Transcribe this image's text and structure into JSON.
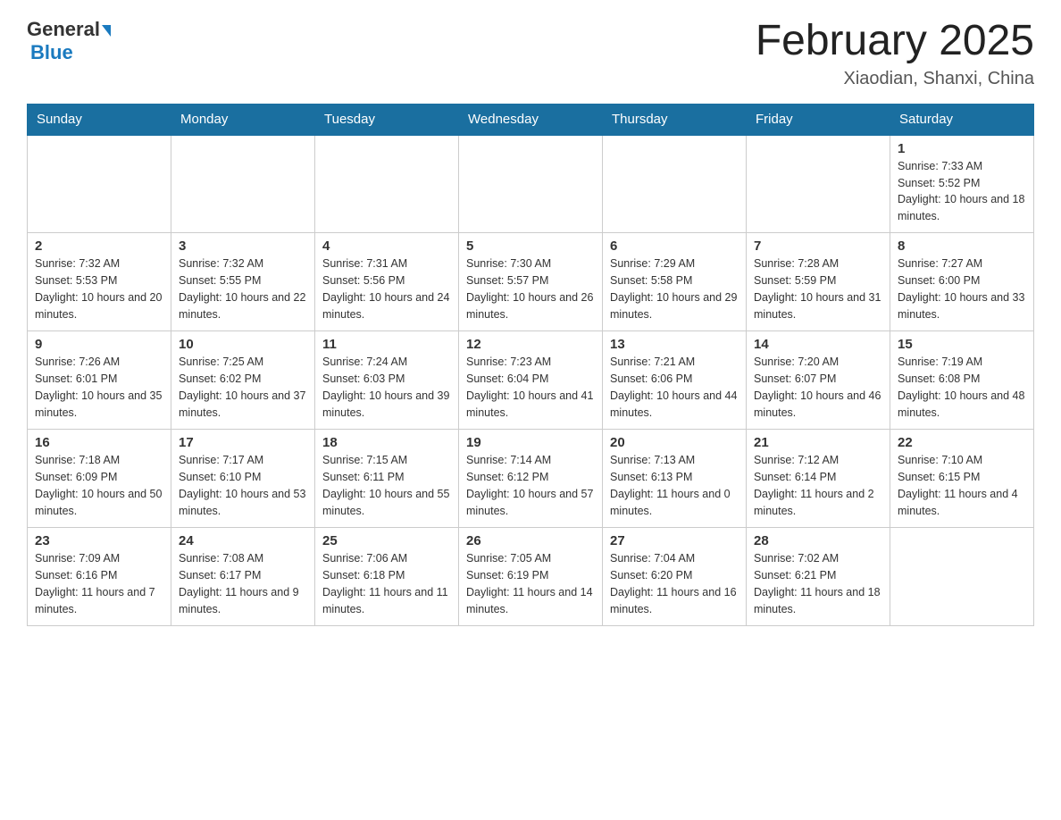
{
  "header": {
    "logo_general": "General",
    "logo_blue": "Blue",
    "title": "February 2025",
    "location": "Xiaodian, Shanxi, China"
  },
  "weekdays": [
    "Sunday",
    "Monday",
    "Tuesday",
    "Wednesday",
    "Thursday",
    "Friday",
    "Saturday"
  ],
  "weeks": [
    [
      {
        "day": "",
        "info": ""
      },
      {
        "day": "",
        "info": ""
      },
      {
        "day": "",
        "info": ""
      },
      {
        "day": "",
        "info": ""
      },
      {
        "day": "",
        "info": ""
      },
      {
        "day": "",
        "info": ""
      },
      {
        "day": "1",
        "info": "Sunrise: 7:33 AM\nSunset: 5:52 PM\nDaylight: 10 hours and 18 minutes."
      }
    ],
    [
      {
        "day": "2",
        "info": "Sunrise: 7:32 AM\nSunset: 5:53 PM\nDaylight: 10 hours and 20 minutes."
      },
      {
        "day": "3",
        "info": "Sunrise: 7:32 AM\nSunset: 5:55 PM\nDaylight: 10 hours and 22 minutes."
      },
      {
        "day": "4",
        "info": "Sunrise: 7:31 AM\nSunset: 5:56 PM\nDaylight: 10 hours and 24 minutes."
      },
      {
        "day": "5",
        "info": "Sunrise: 7:30 AM\nSunset: 5:57 PM\nDaylight: 10 hours and 26 minutes."
      },
      {
        "day": "6",
        "info": "Sunrise: 7:29 AM\nSunset: 5:58 PM\nDaylight: 10 hours and 29 minutes."
      },
      {
        "day": "7",
        "info": "Sunrise: 7:28 AM\nSunset: 5:59 PM\nDaylight: 10 hours and 31 minutes."
      },
      {
        "day": "8",
        "info": "Sunrise: 7:27 AM\nSunset: 6:00 PM\nDaylight: 10 hours and 33 minutes."
      }
    ],
    [
      {
        "day": "9",
        "info": "Sunrise: 7:26 AM\nSunset: 6:01 PM\nDaylight: 10 hours and 35 minutes."
      },
      {
        "day": "10",
        "info": "Sunrise: 7:25 AM\nSunset: 6:02 PM\nDaylight: 10 hours and 37 minutes."
      },
      {
        "day": "11",
        "info": "Sunrise: 7:24 AM\nSunset: 6:03 PM\nDaylight: 10 hours and 39 minutes."
      },
      {
        "day": "12",
        "info": "Sunrise: 7:23 AM\nSunset: 6:04 PM\nDaylight: 10 hours and 41 minutes."
      },
      {
        "day": "13",
        "info": "Sunrise: 7:21 AM\nSunset: 6:06 PM\nDaylight: 10 hours and 44 minutes."
      },
      {
        "day": "14",
        "info": "Sunrise: 7:20 AM\nSunset: 6:07 PM\nDaylight: 10 hours and 46 minutes."
      },
      {
        "day": "15",
        "info": "Sunrise: 7:19 AM\nSunset: 6:08 PM\nDaylight: 10 hours and 48 minutes."
      }
    ],
    [
      {
        "day": "16",
        "info": "Sunrise: 7:18 AM\nSunset: 6:09 PM\nDaylight: 10 hours and 50 minutes."
      },
      {
        "day": "17",
        "info": "Sunrise: 7:17 AM\nSunset: 6:10 PM\nDaylight: 10 hours and 53 minutes."
      },
      {
        "day": "18",
        "info": "Sunrise: 7:15 AM\nSunset: 6:11 PM\nDaylight: 10 hours and 55 minutes."
      },
      {
        "day": "19",
        "info": "Sunrise: 7:14 AM\nSunset: 6:12 PM\nDaylight: 10 hours and 57 minutes."
      },
      {
        "day": "20",
        "info": "Sunrise: 7:13 AM\nSunset: 6:13 PM\nDaylight: 11 hours and 0 minutes."
      },
      {
        "day": "21",
        "info": "Sunrise: 7:12 AM\nSunset: 6:14 PM\nDaylight: 11 hours and 2 minutes."
      },
      {
        "day": "22",
        "info": "Sunrise: 7:10 AM\nSunset: 6:15 PM\nDaylight: 11 hours and 4 minutes."
      }
    ],
    [
      {
        "day": "23",
        "info": "Sunrise: 7:09 AM\nSunset: 6:16 PM\nDaylight: 11 hours and 7 minutes."
      },
      {
        "day": "24",
        "info": "Sunrise: 7:08 AM\nSunset: 6:17 PM\nDaylight: 11 hours and 9 minutes."
      },
      {
        "day": "25",
        "info": "Sunrise: 7:06 AM\nSunset: 6:18 PM\nDaylight: 11 hours and 11 minutes."
      },
      {
        "day": "26",
        "info": "Sunrise: 7:05 AM\nSunset: 6:19 PM\nDaylight: 11 hours and 14 minutes."
      },
      {
        "day": "27",
        "info": "Sunrise: 7:04 AM\nSunset: 6:20 PM\nDaylight: 11 hours and 16 minutes."
      },
      {
        "day": "28",
        "info": "Sunrise: 7:02 AM\nSunset: 6:21 PM\nDaylight: 11 hours and 18 minutes."
      },
      {
        "day": "",
        "info": ""
      }
    ]
  ]
}
